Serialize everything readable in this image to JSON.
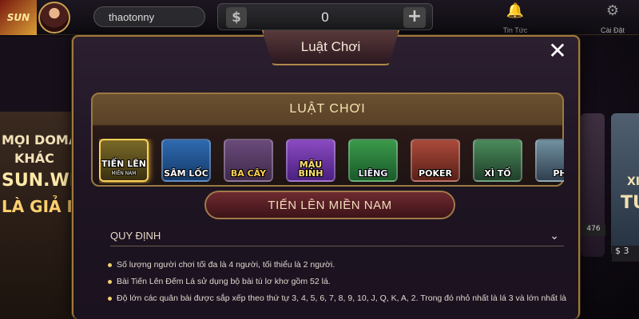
{
  "topbar": {
    "logo_text": "SUN",
    "username": "thaotonny",
    "balance_symbol": "$",
    "balance": "0",
    "plus": "+",
    "nav": [
      {
        "label": "Tin Tức",
        "icon": "bell-icon"
      },
      {
        "label": "Cài Đặt",
        "icon": "gear-icon"
      }
    ]
  },
  "background": {
    "left_banner": [
      "MỌI DOMAI",
      "KHÁC",
      "SUN.WI",
      "LÀ GIẢ MẠ"
    ],
    "right_card_text": [
      "XI",
      "TU"
    ],
    "right_count": "476",
    "right_money": "$ 3"
  },
  "modal": {
    "title": "Luật Chơi",
    "close": "✕",
    "panel_title": "LUẬT CHƠI",
    "games": [
      {
        "label": "TIẾN LÊN",
        "sub": "MIỀN NAM",
        "active": true
      },
      {
        "label": "SÂM LỐC",
        "sub": ""
      },
      {
        "label": "BA CÂY",
        "sub": ""
      },
      {
        "label": "MẬU BINH",
        "sub": ""
      },
      {
        "label": "LIÊNG",
        "sub": ""
      },
      {
        "label": "POKER",
        "sub": ""
      },
      {
        "label": "XÌ TỐ",
        "sub": ""
      },
      {
        "label": "PH",
        "sub": ""
      }
    ],
    "selected_game": "TIẾN LÊN MIỀN NAM",
    "rules_section": "QUY ĐỊNH",
    "rules": [
      "Số lượng người chơi tối đa là 4 người, tối thiểu là 2 người.",
      "Bài Tiến Lên Đếm Lá sử dụng bộ bài tú lơ khơ gồm 52 lá.",
      "Độ lớn các quân bài được sắp xếp theo thứ tự 3, 4, 5, 6, 7, 8, 9, 10, J, Q, K, A, 2. Trong đó nhỏ nhất là lá 3 và lớn nhất là"
    ]
  }
}
